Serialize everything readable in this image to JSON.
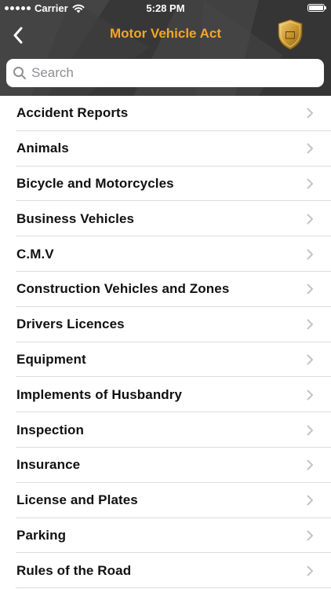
{
  "status_bar": {
    "carrier": "Carrier",
    "time": "5:28 PM"
  },
  "nav": {
    "title": "Motor Vehicle Act",
    "title_color": "#f5a623",
    "back_icon": "chevron-left-icon",
    "badge_icon": "shield-badge-icon"
  },
  "search": {
    "placeholder": "Search",
    "value": ""
  },
  "list": {
    "items": [
      {
        "label": "Accident Reports"
      },
      {
        "label": "Animals"
      },
      {
        "label": "Bicycle and Motorcycles"
      },
      {
        "label": "Business Vehicles"
      },
      {
        "label": "C.M.V"
      },
      {
        "label": "Construction Vehicles and Zones"
      },
      {
        "label": "Drivers Licences"
      },
      {
        "label": "Equipment"
      },
      {
        "label": "Implements of Husbandry"
      },
      {
        "label": "Inspection"
      },
      {
        "label": "Insurance"
      },
      {
        "label": "License and Plates"
      },
      {
        "label": "Parking"
      },
      {
        "label": "Rules of the Road"
      }
    ]
  }
}
